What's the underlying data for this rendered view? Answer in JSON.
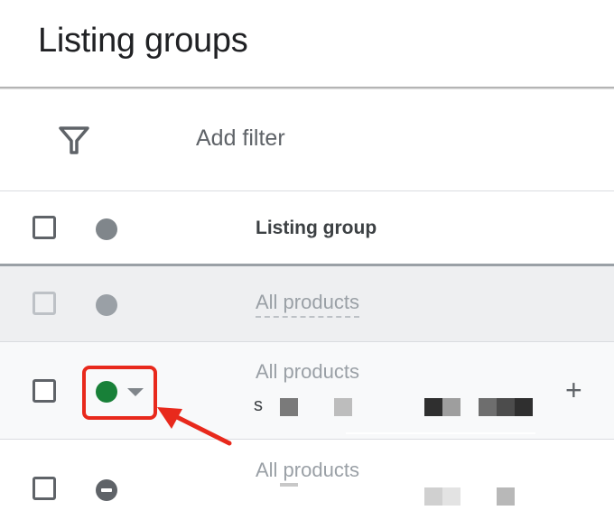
{
  "header": {
    "title": "Listing groups"
  },
  "filter": {
    "add_label": "Add filter"
  },
  "table": {
    "column_label": "Listing group",
    "rows": [
      {
        "label": "All products"
      },
      {
        "label": "All products",
        "sub_prefix": "s"
      },
      {
        "label": "All products"
      }
    ]
  },
  "colors": {
    "status_green": "#188038",
    "annotation_red": "#e8291c"
  },
  "icons": [
    "filter-icon",
    "status-dot-icon",
    "caret-down-icon",
    "plus-icon",
    "excluded-icon",
    "annotation-arrow"
  ]
}
